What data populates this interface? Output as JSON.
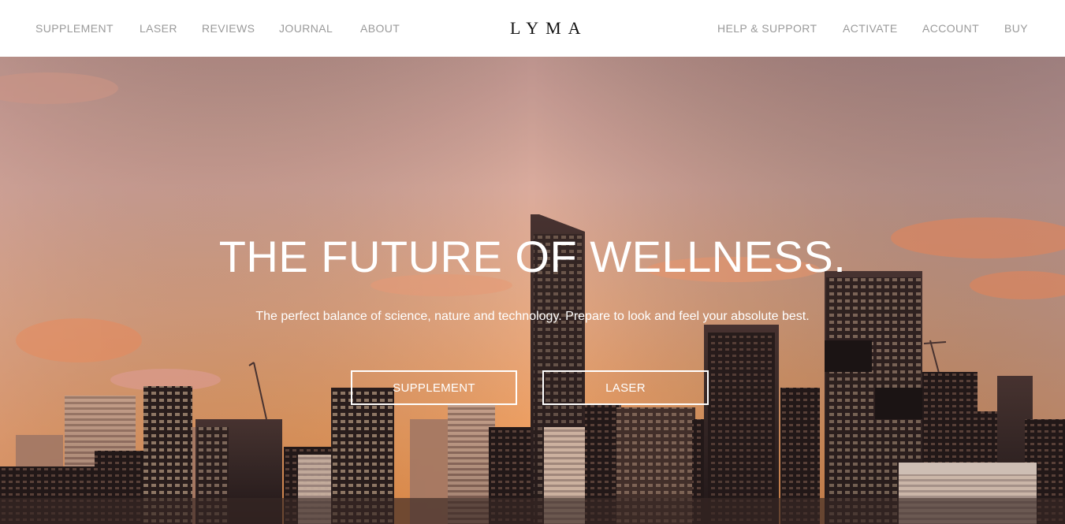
{
  "header": {
    "logo": "LYMA",
    "left_nav": [
      "SUPPLEMENT",
      "LASER",
      "REVIEWS",
      "JOURNAL",
      "ABOUT"
    ],
    "right_nav": [
      "HELP & SUPPORT",
      "ACTIVATE",
      "ACCOUNT",
      "BUY"
    ]
  },
  "hero": {
    "title": "THE FUTURE OF WELLNESS.",
    "subtitle": "The perfect balance of science, nature and technology. Prepare to look and feel your absolute best.",
    "buttons": [
      "SUPPLEMENT",
      "LASER"
    ]
  },
  "colors": {
    "nav_text": "#9a9a9a",
    "logo": "#111111",
    "hero_text": "#ffffff",
    "sky_top": "#c89a8e",
    "sky_bottom": "#f29a55"
  }
}
